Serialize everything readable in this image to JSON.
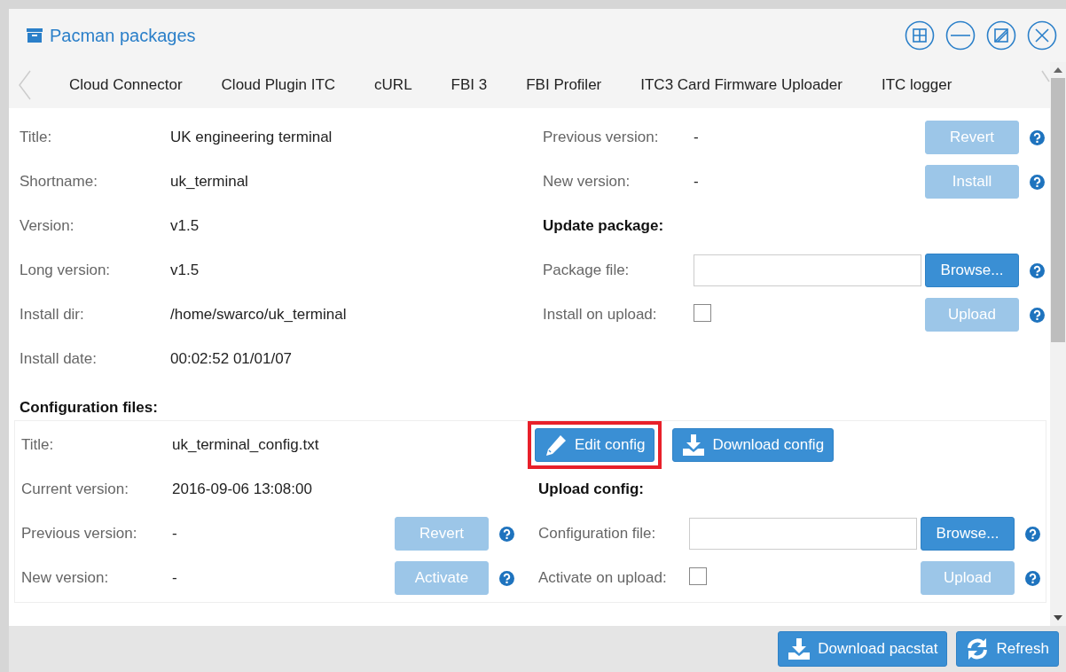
{
  "window": {
    "title": "Pacman packages"
  },
  "window_controls": [
    {
      "kind": "tile"
    },
    {
      "kind": "minimize"
    },
    {
      "kind": "maximize"
    },
    {
      "kind": "close"
    }
  ],
  "tabs": [
    {
      "label": "Cloud Connector",
      "selected": false
    },
    {
      "label": "Cloud Plugin ITC",
      "selected": false
    },
    {
      "label": "cURL",
      "selected": false
    },
    {
      "label": "FBI 3",
      "selected": false
    },
    {
      "label": "FBI Profiler",
      "selected": false
    },
    {
      "label": "ITC3 Card Firmware Uploader",
      "selected": false
    },
    {
      "label": "ITC logger",
      "selected": false
    }
  ],
  "package": {
    "fields": [
      {
        "label": "Title:",
        "value": "UK engineering terminal"
      },
      {
        "label": "Shortname:",
        "value": "uk_terminal"
      },
      {
        "label": "Version:",
        "value": "v1.5"
      },
      {
        "label": "Long version:",
        "value": "v1.5"
      },
      {
        "label": "Install dir:",
        "value": "/home/swarco/uk_terminal"
      },
      {
        "label": "Install date:",
        "value": "00:02:52 01/01/07"
      }
    ],
    "versions": [
      {
        "label": "Previous version:",
        "value": "-",
        "button": "Revert",
        "disabled": true
      },
      {
        "label": "New version:",
        "value": "-",
        "button": "Install",
        "disabled": true
      }
    ],
    "upload": {
      "heading": "Update package:",
      "file_label": "Package file:",
      "browse": "Browse...",
      "checkbox_label": "Install on upload:",
      "checked": false,
      "button": "Upload",
      "disabled": true
    }
  },
  "config": {
    "heading": "Configuration files:",
    "fields": [
      {
        "label": "Title:",
        "value": "uk_terminal_config.txt"
      },
      {
        "label": "Current version:",
        "value": "2016-09-06 13:08:00"
      }
    ],
    "versions": [
      {
        "label": "Previous version:",
        "value": "-",
        "button": "Revert",
        "disabled": true
      },
      {
        "label": "New version:",
        "value": "-",
        "button": "Activate",
        "disabled": true
      }
    ],
    "actions": [
      {
        "kind": "edit",
        "label": "Edit config",
        "highlighted": true
      },
      {
        "kind": "download",
        "label": "Download config",
        "highlighted": false
      }
    ],
    "upload": {
      "heading": "Upload config:",
      "file_label": "Configuration file:",
      "browse": "Browse...",
      "checkbox_label": "Activate on upload:",
      "checked": false,
      "button": "Upload",
      "disabled": true
    }
  },
  "footer": [
    {
      "kind": "download",
      "label": "Download pacstat"
    },
    {
      "kind": "refresh",
      "label": "Refresh"
    }
  ]
}
